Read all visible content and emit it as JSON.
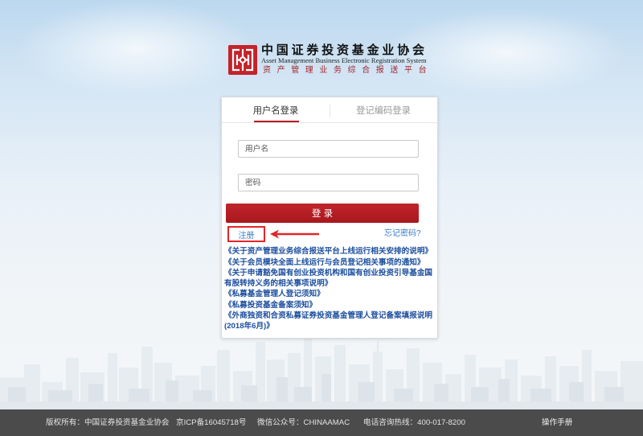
{
  "header": {
    "org_name": "中国证券投资基金业协会",
    "system_name_en": "Asset Management Business Electronic Registration System",
    "system_name_cn": "资产管理业务综合报送平台"
  },
  "login": {
    "tabs": [
      {
        "label": "用户名登录",
        "active": true
      },
      {
        "label": "登记编码登录",
        "active": false
      }
    ],
    "username_placeholder": "用户名",
    "password_placeholder": "密码",
    "submit_label": "登 录",
    "register_label": "注册",
    "forgot_password_label": "忘记密码?"
  },
  "notices": [
    "《关于资产管理业务综合报送平台上线运行相关安排的说明》",
    "《关于会员模块全面上线运行与会员登记相关事项的通知》",
    "《关于申请豁免国有创业投资机构和国有创业投资引导基金国有股转持义务的相关事项说明》",
    "《私募基金管理人登记须知》",
    "《私募投资基金备案须知》",
    "《外商独资和合资私募证券投资基金管理人登记备案填报说明(2018年6月)》"
  ],
  "footer": {
    "copyright": "版权所有：中国证券投资基金业协会",
    "icp": "京ICP备16045718号",
    "wechat": "微信公众号：CHINAAMAC",
    "hotline": "电话咨询热线：400-017-8200",
    "manual_label": "操作手册"
  },
  "icons": {
    "logo": "amac-seal-logo-icon",
    "annotation_arrow": "arrow-left-icon"
  },
  "colors": {
    "brand_red": "#b31b21",
    "annotation_red": "#e2262b",
    "notice_link_blue": "#1b4e9e",
    "link_blue": "#3a7bc8",
    "footer_bg": "#4b4b4b"
  }
}
